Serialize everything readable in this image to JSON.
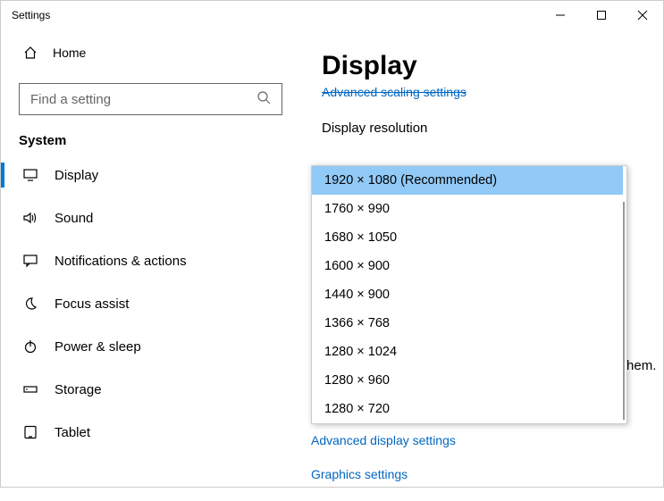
{
  "window": {
    "title": "Settings"
  },
  "sidebar": {
    "home_label": "Home",
    "search_placeholder": "Find a setting",
    "category": "System",
    "items": [
      {
        "label": "Display",
        "icon": "monitor-icon",
        "selected": true
      },
      {
        "label": "Sound",
        "icon": "speaker-icon",
        "selected": false
      },
      {
        "label": "Notifications & actions",
        "icon": "chat-icon",
        "selected": false
      },
      {
        "label": "Focus assist",
        "icon": "moon-icon",
        "selected": false
      },
      {
        "label": "Power & sleep",
        "icon": "power-icon",
        "selected": false
      },
      {
        "label": "Storage",
        "icon": "storage-icon",
        "selected": false
      },
      {
        "label": "Tablet",
        "icon": "tablet-icon",
        "selected": false
      }
    ]
  },
  "main": {
    "title": "Display",
    "truncated_link_above": "Advanced scaling settings",
    "resolution_label": "Display resolution",
    "dropdown_options": [
      {
        "label": "1920 × 1080 (Recommended)",
        "selected": true
      },
      {
        "label": "1760 × 990",
        "selected": false
      },
      {
        "label": "1680 × 1050",
        "selected": false
      },
      {
        "label": "1600 × 900",
        "selected": false
      },
      {
        "label": "1440 × 900",
        "selected": false
      },
      {
        "label": "1366 × 768",
        "selected": false
      },
      {
        "label": "1280 × 1024",
        "selected": false
      },
      {
        "label": "1280 × 960",
        "selected": false
      },
      {
        "label": "1280 × 720",
        "selected": false
      }
    ],
    "peek_text": "ect to them.",
    "link_advanced": "Advanced display settings",
    "link_graphics": "Graphics settings"
  }
}
